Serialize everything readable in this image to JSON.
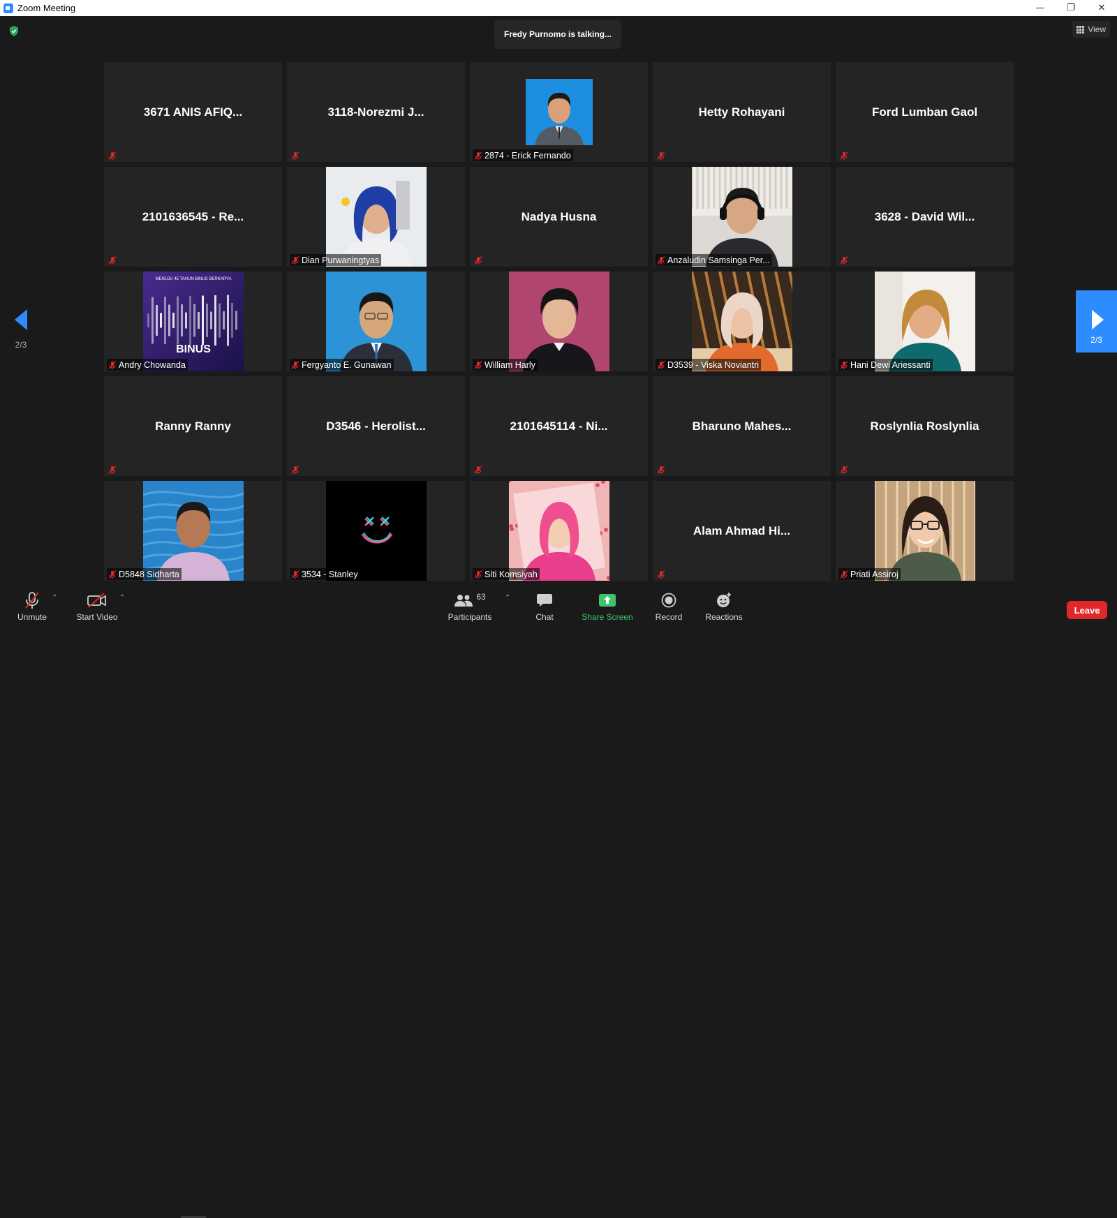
{
  "window": {
    "title": "Zoom Meeting",
    "minimize": "—",
    "restore": "❐",
    "close": "✕"
  },
  "header": {
    "talking": "Fredy Purnomo is talking...",
    "view_label": "View"
  },
  "pagination": {
    "left_page": "2/3",
    "right_page": "2/3"
  },
  "participants": [
    {
      "name": "3671  ANIS AFIQ...",
      "video": false,
      "muted": true
    },
    {
      "name": "3118-Norezmi  J...",
      "video": false,
      "muted": true
    },
    {
      "name": "2874 - Erick Fernando",
      "video": true,
      "thumb": "suit-blue",
      "small": true,
      "muted": true
    },
    {
      "name": "Hetty Rohayani",
      "video": false,
      "muted": true
    },
    {
      "name": "Ford Lumban Gaol",
      "video": false,
      "muted": true
    },
    {
      "name": "2101636545 - Re...",
      "video": false,
      "muted": true
    },
    {
      "name": "Dian Purwaningtyas",
      "video": true,
      "thumb": "hijab-blue",
      "muted": true
    },
    {
      "name": "Nadya Husna",
      "video": false,
      "muted": true
    },
    {
      "name": "Anzaludin Samsinga Per...",
      "video": true,
      "thumb": "headset",
      "muted": true
    },
    {
      "name": "3628  - David Wil...",
      "video": false,
      "muted": true
    },
    {
      "name": "Andry Chowanda",
      "video": true,
      "thumb": "binus",
      "muted": true
    },
    {
      "name": "Fergyanto E. Gunawan",
      "video": true,
      "thumb": "suit-blue2",
      "muted": true
    },
    {
      "name": "William Harly",
      "video": true,
      "thumb": "pink-bg",
      "muted": true
    },
    {
      "name": "D3539 - Viska Noviantri",
      "video": true,
      "thumb": "hijab-cafe",
      "muted": true
    },
    {
      "name": "Hani Dewi Ariessanti",
      "video": true,
      "thumb": "selfie",
      "muted": true
    },
    {
      "name": "Ranny Ranny",
      "video": false,
      "muted": true
    },
    {
      "name": "D3546  - Herolist...",
      "video": false,
      "muted": true
    },
    {
      "name": "2101645114 - Ni...",
      "video": false,
      "muted": true
    },
    {
      "name": "Bharuno  Mahes...",
      "video": false,
      "muted": true
    },
    {
      "name": "Roslynlia Roslynlia",
      "video": false,
      "muted": true
    },
    {
      "name": "D5848 Sidharta",
      "video": true,
      "thumb": "blue-wave",
      "muted": true
    },
    {
      "name": "3534 - Stanley",
      "video": true,
      "thumb": "black-smile",
      "muted": true
    },
    {
      "name": "Siti Komsiyah",
      "video": true,
      "thumb": "floral",
      "muted": true
    },
    {
      "name": "Alam  Ahmad  Hi...",
      "video": false,
      "muted": true
    },
    {
      "name": "Priati Assiroj",
      "video": true,
      "thumb": "glasses",
      "muted": true
    }
  ],
  "binus_text": {
    "line1": "MENUJU 45 TAHUN BINUS BERKARYA",
    "word": "BINUS"
  },
  "toolbar": {
    "unmute": "Unmute",
    "start_video": "Start Video",
    "participants": "Participants",
    "participants_count": "63",
    "chat": "Chat",
    "share": "Share Screen",
    "record": "Record",
    "reactions": "Reactions",
    "leave": "Leave"
  },
  "colors": {
    "accent": "#2d8cff",
    "share_green": "#3ec46d",
    "leave_red": "#e02828",
    "mute_red": "#e02828"
  }
}
